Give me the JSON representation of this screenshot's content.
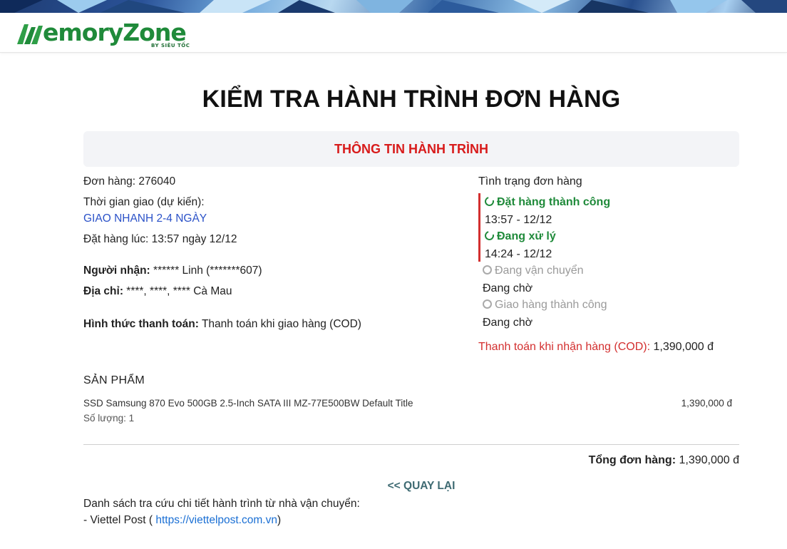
{
  "brand": {
    "logo_text_main": "MemoryZone",
    "logo_text_sub": "BY SIÊU TỐC",
    "color_green": "#1f8a3a"
  },
  "page": {
    "title": "KIỂM TRA HÀNH TRÌNH ĐƠN HÀNG",
    "section_title": "THÔNG TIN HÀNH TRÌNH"
  },
  "order": {
    "number_label": "Đơn hàng:",
    "number_value": "276040",
    "delivery_label": "Thời gian giao (dự kiến):",
    "delivery_value": "GIAO NHANH 2-4 NGÀY",
    "ordered_at": "Đặt hàng lúc: 13:57 ngày 12/12",
    "recipient_label": "Người nhận:",
    "recipient_value": "****** Linh (*******607)",
    "address_label": "Địa chỉ:",
    "address_value": "****, ****, **** Cà Mau",
    "payment_label": "Hình thức thanh toán:",
    "payment_value": "Thanh toán khi giao hàng (COD)"
  },
  "status": {
    "heading": "Tình trạng đơn hàng",
    "steps": [
      {
        "label": "Đặt hàng thành công",
        "sub": "13:57 - 12/12",
        "state": "done"
      },
      {
        "label": "Đang xử lý",
        "sub": "14:24 - 12/12",
        "state": "done"
      },
      {
        "label": "Đang vận chuyển",
        "sub": "Đang chờ",
        "state": "pending"
      },
      {
        "label": "Giao hàng thành công",
        "sub": "Đang chờ",
        "state": "pending"
      }
    ],
    "cod_label": "Thanh toán khi nhận hàng (COD):",
    "cod_value": "1,390,000 đ",
    "color_done": "#1f8a3a",
    "color_accent": "#d32f2f"
  },
  "products": {
    "heading": "SẢN PHẨM",
    "items": [
      {
        "name": "SSD Samsung 870 Evo 500GB 2.5-Inch SATA III MZ-77E500BW Default Title",
        "quantity": "Số lượng: 1",
        "price": "1,390,000 đ"
      }
    ],
    "total_label": "Tổng đơn hàng:",
    "total_value": "1,390,000 đ"
  },
  "navigation": {
    "back_label": "<< QUAY LẠI"
  },
  "carriers": {
    "note": "Danh sách tra cứu chi tiết hành trình từ nhà vận chuyển:",
    "viettel_prefix": "- Viettel Post ( ",
    "viettel_link": "https://viettelpost.com.vn",
    "viettel_suffix": ")"
  }
}
